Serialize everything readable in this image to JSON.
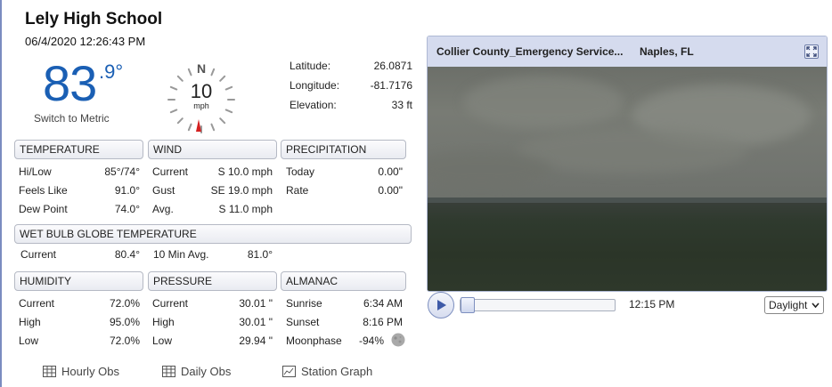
{
  "station": {
    "name": "Lely High School",
    "datetime": "06/4/2020 12:26:43 PM",
    "temp_whole": "83",
    "temp_decimal": ".9°",
    "metric_link": "Switch to Metric"
  },
  "compass": {
    "north": "N",
    "speed": "10",
    "unit": "mph"
  },
  "geo": [
    {
      "label": "Latitude:",
      "value": "26.0871"
    },
    {
      "label": "Longitude:",
      "value": "-81.7176"
    },
    {
      "label": "Elevation:",
      "value": "33 ft"
    }
  ],
  "temperature": {
    "title": "TEMPERATURE",
    "rows": [
      {
        "label": "Hi/Low",
        "value": "85°/74°"
      },
      {
        "label": "Feels Like",
        "value": "91.0°"
      },
      {
        "label": "Dew Point",
        "value": "74.0°"
      }
    ]
  },
  "wind": {
    "title": "WIND",
    "rows": [
      {
        "label": "Current",
        "value": "S 10.0 mph"
      },
      {
        "label": "Gust",
        "value": "SE 19.0 mph"
      },
      {
        "label": "Avg.",
        "value": "S 11.0 mph"
      }
    ]
  },
  "precipitation": {
    "title": "PRECIPITATION",
    "rows": [
      {
        "label": "Today",
        "value": "0.00\""
      },
      {
        "label": "Rate",
        "value": "0.00\""
      }
    ]
  },
  "wbgt": {
    "title": "WET BULB GLOBE TEMPERATURE",
    "current_label": "Current",
    "current_value": "80.4°",
    "avg_label": "10 Min Avg.",
    "avg_value": "81.0°"
  },
  "humidity": {
    "title": "HUMIDITY",
    "rows": [
      {
        "label": "Current",
        "value": "72.0%"
      },
      {
        "label": "High",
        "value": "95.0%"
      },
      {
        "label": "Low",
        "value": "72.0%"
      }
    ]
  },
  "pressure": {
    "title": "PRESSURE",
    "rows": [
      {
        "label": "Current",
        "value": "30.01 \""
      },
      {
        "label": "High",
        "value": "30.01 \""
      },
      {
        "label": "Low",
        "value": "29.94 \""
      }
    ]
  },
  "almanac": {
    "title": "ALMANAC",
    "rows": [
      {
        "label": "Sunrise",
        "value": "6:34 AM"
      },
      {
        "label": "Sunset",
        "value": "8:16 PM"
      },
      {
        "label": "Moonphase",
        "value": "-94%"
      }
    ]
  },
  "footer": {
    "hourly": "Hourly Obs",
    "daily": "Daily Obs",
    "graph": "Station Graph"
  },
  "camera": {
    "title": "Collier County_Emergency Service...",
    "location": "Naples, FL",
    "time": "12:15 PM",
    "mode": "Daylight",
    "progress": 0.0
  },
  "colors": {
    "accent": "#1a5fb4",
    "wind_arrow": "#d42020"
  }
}
